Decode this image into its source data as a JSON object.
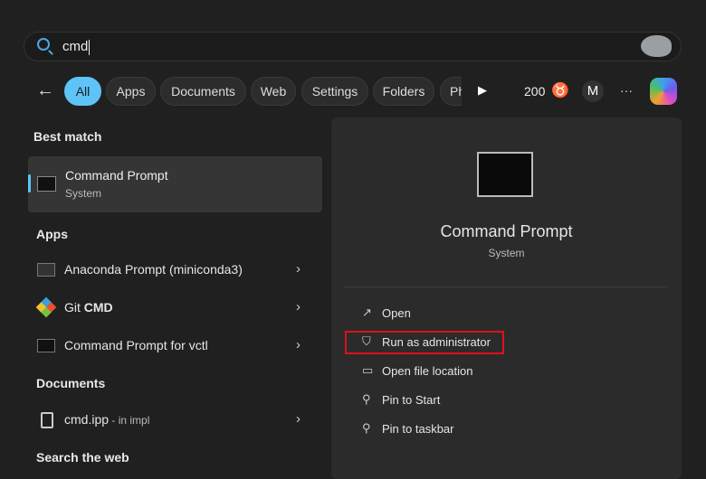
{
  "search": {
    "value": "cmd"
  },
  "filters": {
    "back": "←",
    "tabs": [
      "All",
      "Apps",
      "Documents",
      "Web",
      "Settings",
      "Folders",
      "Ph"
    ],
    "more_arrow": "▶",
    "points": "200",
    "profile": "M",
    "more": "···"
  },
  "left": {
    "best_match_heading": "Best match",
    "best_match": {
      "title": "Command Prompt",
      "subtitle": "System"
    },
    "apps_heading": "Apps",
    "apps": [
      {
        "label": "Anaconda Prompt (miniconda3)"
      },
      {
        "label_pre": "Git ",
        "label_bold": "CMD"
      },
      {
        "label": "Command Prompt for vctl"
      }
    ],
    "documents_heading": "Documents",
    "documents": [
      {
        "name": "cmd.ipp",
        "location": " - in impl"
      }
    ],
    "web_heading": "Search the web",
    "chevron": "›"
  },
  "right": {
    "title": "Command Prompt",
    "subtitle": "System",
    "actions": [
      {
        "label": "Open",
        "icon": "↗"
      },
      {
        "label": "Run as administrator",
        "icon": "⛉"
      },
      {
        "label": "Open file location",
        "icon": "▭"
      },
      {
        "label": "Pin to Start",
        "icon": "⚲"
      },
      {
        "label": "Pin to taskbar",
        "icon": "⚲"
      }
    ],
    "highlight_color": "#e0101a"
  }
}
